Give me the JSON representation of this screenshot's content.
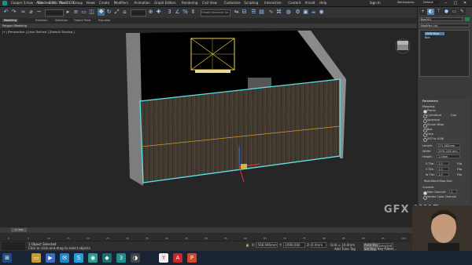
{
  "window": {
    "title": "Cooper 3.max - Autodesk 3ds Max 2020",
    "signin": "Sign In",
    "workspaces_label": "Workspaces:",
    "workspace_value": "Default"
  },
  "menus": [
    "File",
    "Edit",
    "Tools",
    "Group",
    "Views",
    "Create",
    "Modifiers",
    "Animation",
    "Graph Editors",
    "Rendering",
    "Civil View",
    "Customize",
    "Scripting",
    "Interactive",
    "Content",
    "Arnold",
    "Help"
  ],
  "toolbar": {
    "selection_set": "Create Selection Se"
  },
  "ribbon": {
    "tabs": [
      "Modeling",
      "Freeform",
      "Selection",
      "Object Paint",
      "Populate"
    ],
    "sub": "Polygon Modeling"
  },
  "viewport": {
    "label": "[+] [Perspective ] [User Defined ] [Default Shading ]"
  },
  "command_panel": {
    "object_name": "Box001",
    "modifier_list_label": "Modifier List",
    "stack": [
      "UVW Map",
      "Box"
    ],
    "parameters_title": "Parameters",
    "mapping_label": "Mapping:",
    "mapping_options": [
      "Planar",
      "Cylindrical",
      "Spherical",
      "Shrink Wrap",
      "Box",
      "Face",
      "XYZ to UVW"
    ],
    "cap_label": "Cap",
    "length_label": "Length:",
    "length_value": "271.562mm",
    "width_label": "Width:",
    "width_value": "2931.226 mm",
    "height_label": "Height:",
    "height_value": "1.0mm",
    "utile_label": "U Tile:",
    "utile_value": "1.0",
    "vtile_label": "V Tile:",
    "vtile_value": "1.0",
    "wtile_label": "W Tile:",
    "wtile_value": "1.0",
    "flip_label": "Flip",
    "real_world_label": "Real-World Map Size",
    "channel_label": "Channel:",
    "map_channel_label": "Map Channel:",
    "map_channel_value": "1",
    "vertex_color_label": "Vertex Color Channel"
  },
  "timeline": {
    "frame": "0 / 100",
    "ticks": [
      "0",
      "5",
      "10",
      "15",
      "20",
      "25",
      "30",
      "35",
      "40",
      "45",
      "50",
      "55",
      "60",
      "65",
      "70",
      "75",
      "80",
      "85",
      "90",
      "95",
      "100"
    ]
  },
  "status": {
    "selected": "1 Object Selected",
    "hint": "Click or click-and-drag to select objects",
    "x_label": "X:",
    "x_value": "-508.996mm",
    "y_label": "Y:",
    "y_value": "-1698.666",
    "z_label": "Z:",
    "z_value": "0.0mm",
    "grid": "Grid = 10.0mm",
    "add_time_tag": "Add Time Tag",
    "autokey": "Auto Key",
    "setkey": "Set Key",
    "selected_dd": "Selected",
    "key_filters": "Key Filters..."
  },
  "watermark": "GFX HUB",
  "colors": {
    "accent": "#4e7eb0",
    "selection_cyan": "#5fe3e8",
    "wood": "#3c352b"
  }
}
